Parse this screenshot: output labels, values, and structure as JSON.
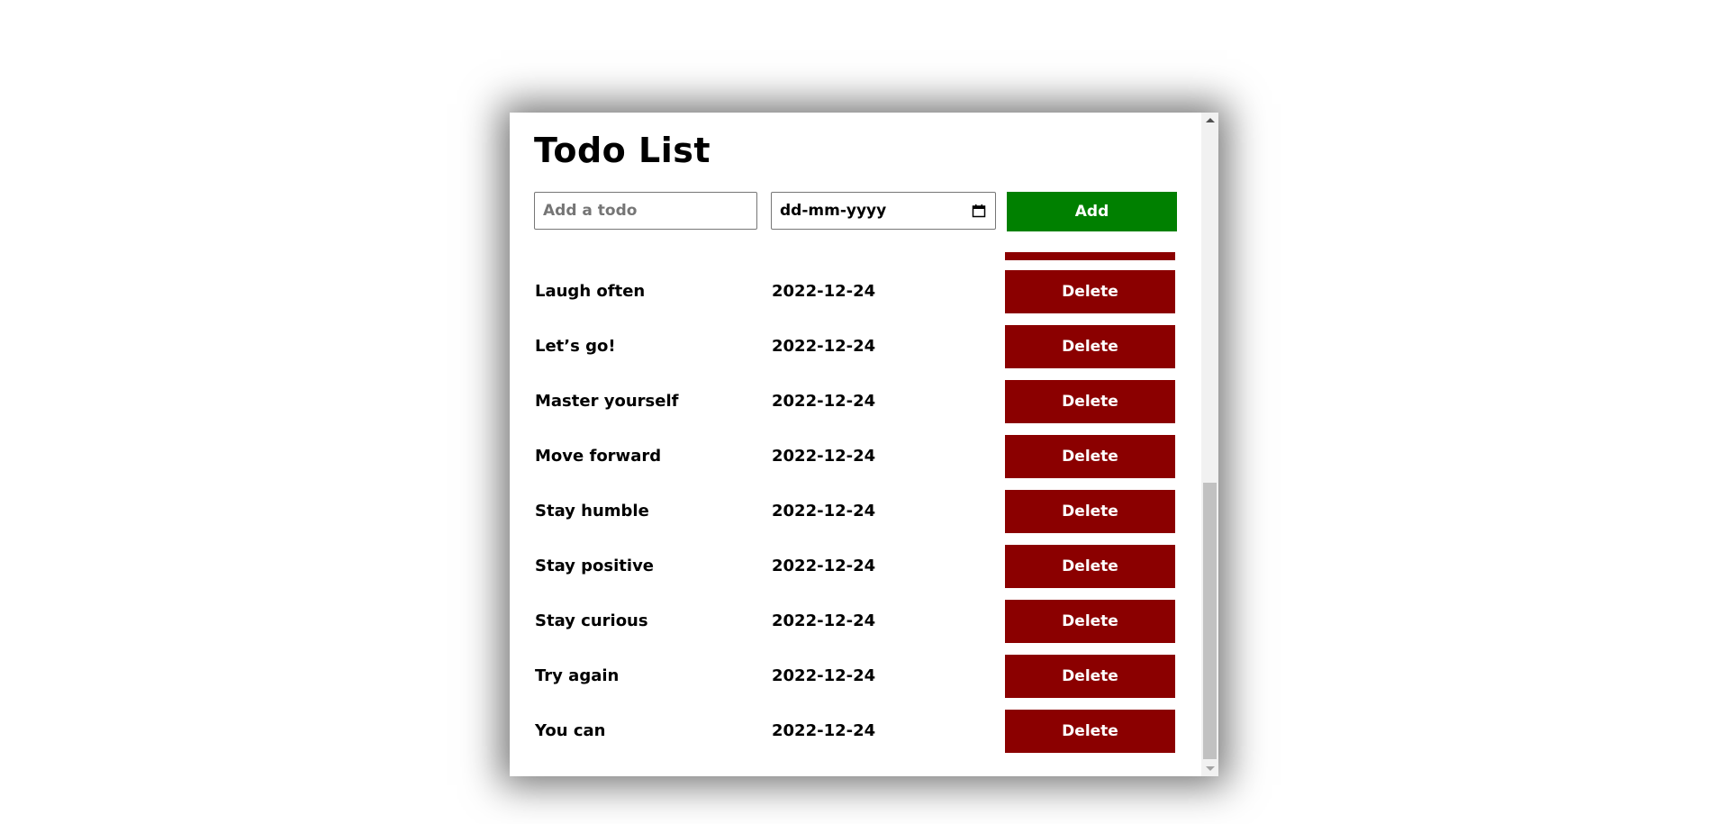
{
  "app": {
    "title": "Todo List"
  },
  "form": {
    "todo_placeholder": "Add a todo",
    "todo_value": "",
    "date_placeholder": "dd-mm-yyyy",
    "add_label": "Add"
  },
  "todos": [
    {
      "text": "Laugh often",
      "date": "2022-12-24",
      "delete_label": "Delete"
    },
    {
      "text": "Let’s go!",
      "date": "2022-12-24",
      "delete_label": "Delete"
    },
    {
      "text": "Master yourself",
      "date": "2022-12-24",
      "delete_label": "Delete"
    },
    {
      "text": "Move forward",
      "date": "2022-12-24",
      "delete_label": "Delete"
    },
    {
      "text": "Stay humble",
      "date": "2022-12-24",
      "delete_label": "Delete"
    },
    {
      "text": "Stay positive",
      "date": "2022-12-24",
      "delete_label": "Delete"
    },
    {
      "text": "Stay curious",
      "date": "2022-12-24",
      "delete_label": "Delete"
    },
    {
      "text": "Try again",
      "date": "2022-12-24",
      "delete_label": "Delete"
    },
    {
      "text": "You can",
      "date": "2022-12-24",
      "delete_label": "Delete"
    }
  ],
  "colors": {
    "add_button": "#008000",
    "delete_button": "#8b0000"
  },
  "icons": {
    "calendar": "calendar-icon",
    "scroll_up": "scroll-up-arrow-icon",
    "scroll_down": "scroll-down-arrow-icon"
  }
}
